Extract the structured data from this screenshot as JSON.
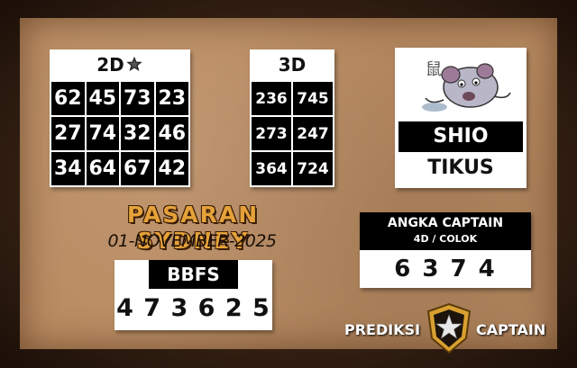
{
  "two_d": {
    "title": "2D",
    "title_icon": "star-icon",
    "rows": [
      [
        "62",
        "45",
        "73",
        "23"
      ],
      [
        "27",
        "74",
        "32",
        "46"
      ],
      [
        "34",
        "64",
        "67",
        "42"
      ]
    ]
  },
  "three_d": {
    "title": "3D",
    "rows": [
      [
        "236",
        "745"
      ],
      [
        "273",
        "247"
      ],
      [
        "364",
        "724"
      ]
    ]
  },
  "shio": {
    "icon": "rat-icon",
    "label": "SHIO",
    "value": "TIKUS"
  },
  "market": {
    "title": "PASARAN SYDNEY",
    "date": "01-NOVEMBER-2025"
  },
  "bbfs": {
    "label": "BBFS",
    "value": "4 7 3 6 2 5"
  },
  "angka_captain": {
    "label": "ANGKA CAPTAIN",
    "sublabel": "4D / COLOK",
    "value": "6 3 7 4"
  },
  "brand": {
    "left": "PREDIKSI",
    "right": "CAPTAIN",
    "emblem": "shield-star-icon"
  },
  "colors": {
    "board": "#b98b61",
    "title_orange": "#e5a23a",
    "cell_black": "#000000",
    "emblem_gold": "#d9a030"
  }
}
